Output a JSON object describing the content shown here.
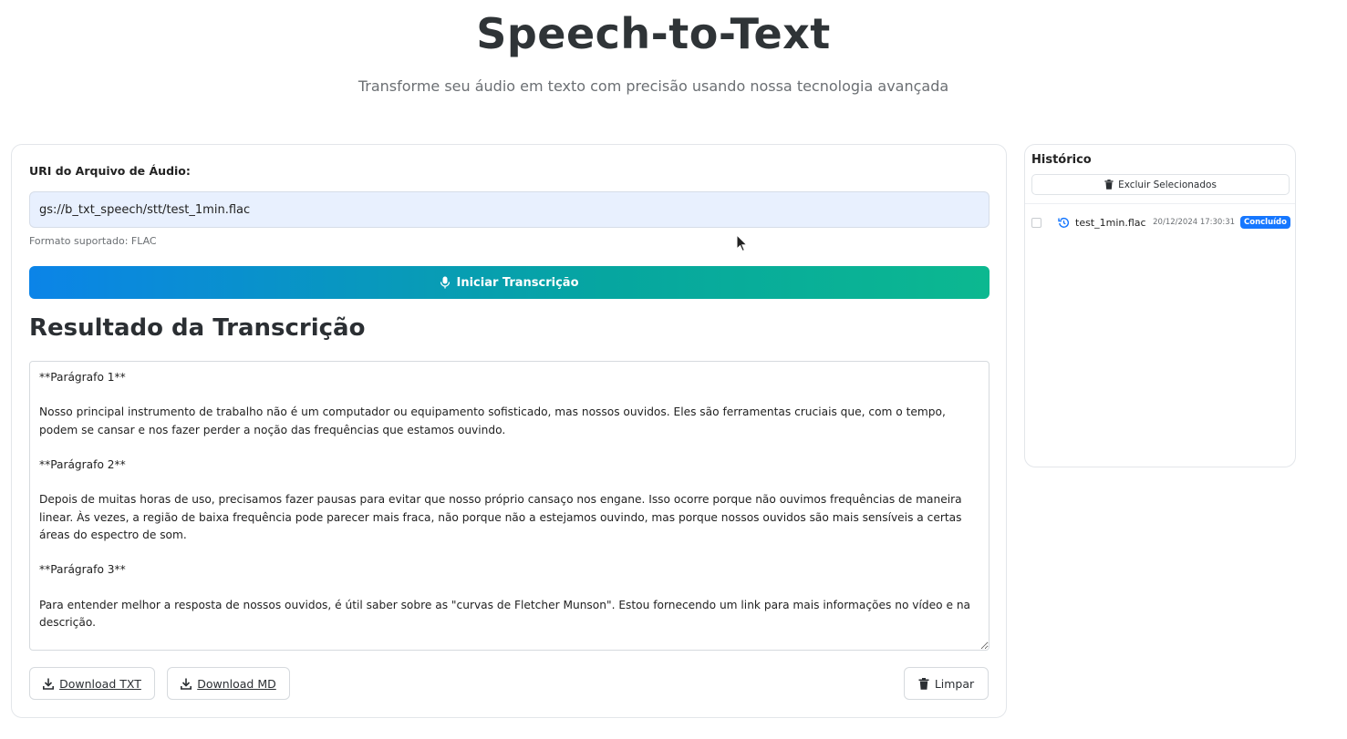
{
  "header": {
    "title": "Speech-to-Text",
    "subtitle": "Transforme seu áudio em texto com precisão usando nossa tecnologia avançada"
  },
  "form": {
    "uri_label": "URI do Arquivo de Áudio:",
    "uri_value": "gs://b_txt_speech/stt/test_1min.flac",
    "format_hint": "Formato suportado: FLAC",
    "start_button": "Iniciar Transcrição",
    "start_icon": "microphone-icon"
  },
  "result": {
    "title": "Resultado da Transcrição",
    "text": "**Parágrafo 1**\n\nNosso principal instrumento de trabalho não é um computador ou equipamento sofisticado, mas nossos ouvidos. Eles são ferramentas cruciais que, com o tempo, podem se cansar e nos fazer perder a noção das frequências que estamos ouvindo.\n\n**Parágrafo 2**\n\nDepois de muitas horas de uso, precisamos fazer pausas para evitar que nosso próprio cansaço nos engane. Isso ocorre porque não ouvimos frequências de maneira linear. Às vezes, a região de baixa frequência pode parecer mais fraca, não porque não a estejamos ouvindo, mas porque nossos ouvidos são mais sensíveis a certas áreas do espectro de som.\n\n**Parágrafo 3**\n\nPara entender melhor a resposta de nossos ouvidos, é útil saber sobre as \"curvas de Fletcher Munson\". Estou fornecendo um link para mais informações no vídeo e na descrição.",
    "download_txt": "Download TXT",
    "download_md": "Download MD",
    "clear": "Limpar"
  },
  "history": {
    "title": "Histórico",
    "delete_selected": "Excluir Selecionados",
    "items": [
      {
        "file": "test_1min.flac",
        "date": "20/12/2024 17:30:31",
        "status": "Concluído",
        "checked": false
      }
    ]
  },
  "colors": {
    "gradient_start": "#0b84e8",
    "gradient_end": "#0cb890",
    "badge": "#1677ff",
    "input_bg": "#e8f0fe"
  }
}
